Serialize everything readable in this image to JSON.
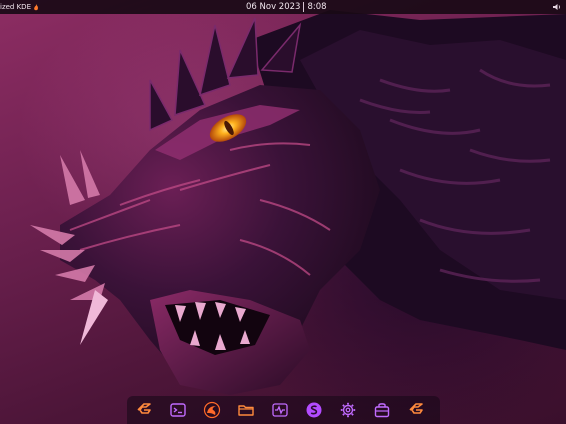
{
  "top_panel": {
    "app_menu_label": "ized KDE",
    "app_menu_icon": "flame-icon",
    "date": "06 Nov 2023",
    "time": "8:08",
    "tray_icon": "volume-icon"
  },
  "dock": {
    "items": [
      {
        "name": "garuda-launcher-icon",
        "color": "#ff8a3d"
      },
      {
        "name": "terminal-icon",
        "color": "#c16bff"
      },
      {
        "name": "browser-icon",
        "color": "#ff6a2a"
      },
      {
        "name": "file-manager-icon",
        "color": "#ff8a3d"
      },
      {
        "name": "system-monitor-icon",
        "color": "#c16bff"
      },
      {
        "name": "s-app-icon",
        "color": "#b34bff"
      },
      {
        "name": "settings-icon",
        "color": "#c16bff"
      },
      {
        "name": "store-icon",
        "color": "#c16bff"
      },
      {
        "name": "garuda-welcome-icon",
        "color": "#ff8a3d"
      }
    ]
  },
  "wallpaper": {
    "subject": "dragon-head",
    "colors": {
      "background_light": "#8d2d63",
      "background_dark": "#3a0f2c",
      "dragon_dark": "#1e0a22",
      "dragon_mid": "#4a1748",
      "highlight": "#c04a86",
      "eye": "#ffb21e"
    }
  }
}
